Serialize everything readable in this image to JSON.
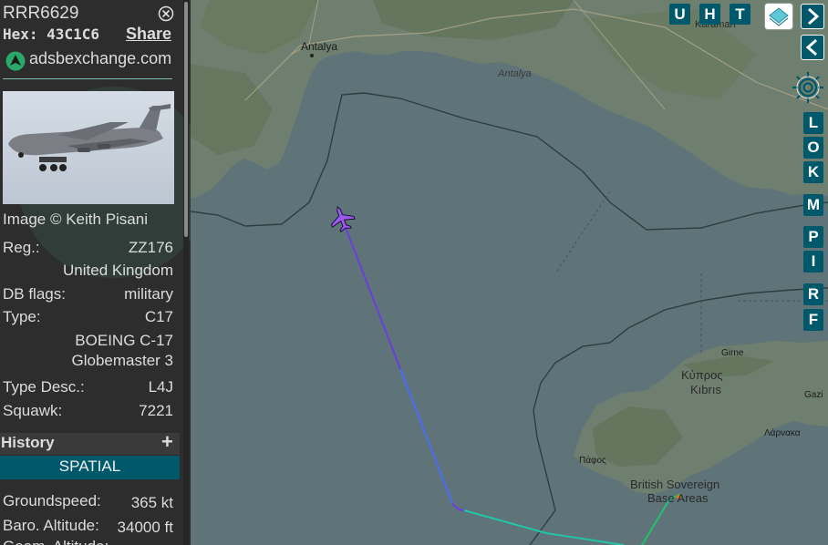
{
  "aircraft": {
    "callsign": "RRR6629",
    "hex_label": "Hex:",
    "hex": "43C1C6",
    "share_label": "Share",
    "source_site": "adsbexchange.com",
    "photo_credit": "Image © Keith Pisani"
  },
  "details": {
    "reg_label": "Reg.:",
    "reg": "ZZ176",
    "country": "United Kingdom",
    "dbflags_label": "DB flags:",
    "dbflags": "military",
    "type_label": "Type:",
    "type": "C17",
    "type_name_line1": "BOEING C-17",
    "type_name_line2": "Globemaster 3",
    "typedesc_label": "Type Desc.:",
    "typedesc": "L4J",
    "squawk_label": "Squawk:",
    "squawk": "7221"
  },
  "history": {
    "label": "History",
    "expand_symbol": "+",
    "tab": "SPATIAL"
  },
  "spatial": {
    "groundspeed_label": "Groundspeed:",
    "groundspeed": "365 kt",
    "baro_alt_label": "Baro. Altitude:",
    "baro_alt": "34000 ft",
    "geom_alt_label": "Geom. Altitude:"
  },
  "map_labels": {
    "antalya_city": "Antalya",
    "antalya_region": "Antalya",
    "karaman": "Karaman",
    "cyprus_gr": "Κύπρος",
    "cyprus_tr": "Kıbrıs",
    "girne": "Girne",
    "gazimagusa": "Gazi",
    "larnaca": "Λάρνακα",
    "paphos": "Πάφος",
    "sba_line1": "British Sovereign",
    "sba_line2": "Base Areas"
  },
  "controls": {
    "top_buttons": [
      "U",
      "H",
      "T"
    ],
    "side_buttons": [
      "L",
      "O",
      "K",
      "M",
      "P",
      "I",
      "R",
      "F"
    ]
  },
  "colors": {
    "accent": "#00596b",
    "sidebar_bg": "#2d2d2d",
    "sea": "#5e7479",
    "aircraft": "#9b59f0"
  }
}
